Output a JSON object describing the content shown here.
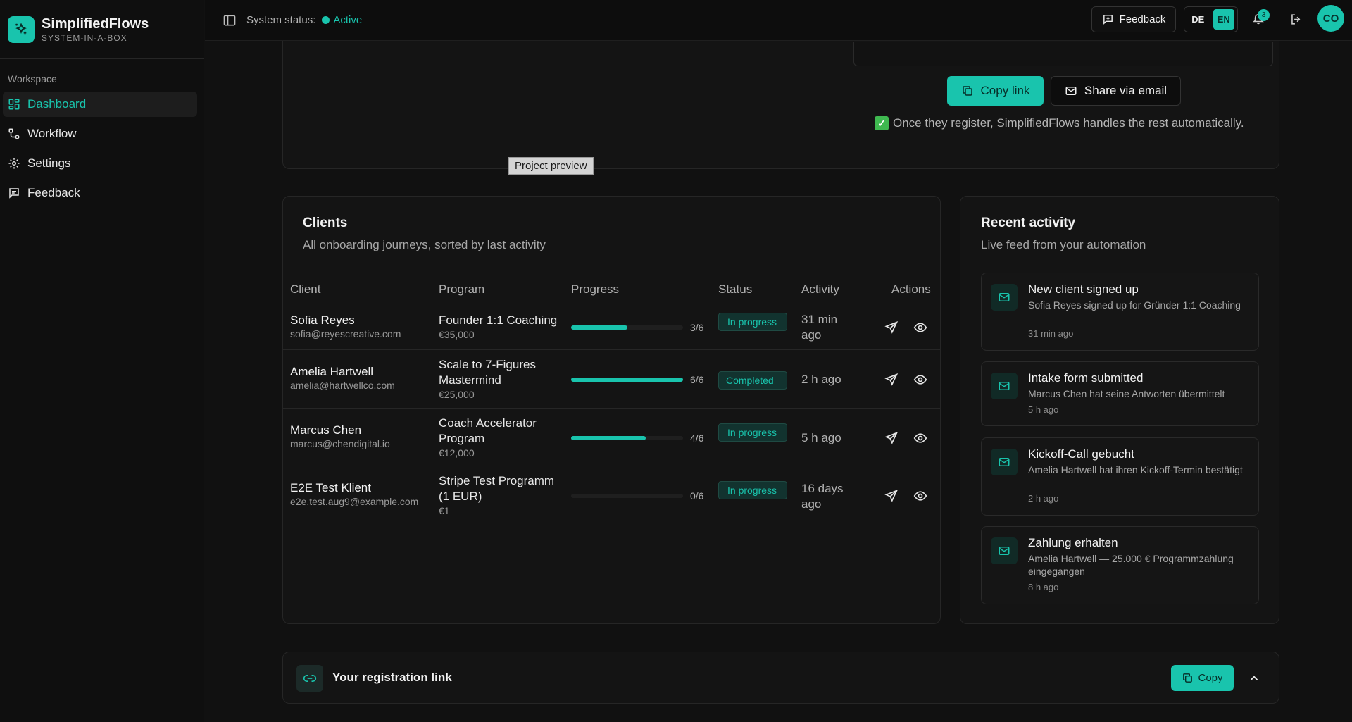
{
  "brand": {
    "name": "SimplifiedFlows",
    "tagline": "SYSTEM-IN-A-BOX"
  },
  "sidebar": {
    "section_label": "Workspace",
    "items": [
      {
        "label": "Dashboard",
        "icon": "dashboard-icon",
        "active": true
      },
      {
        "label": "Workflow",
        "icon": "workflow-icon",
        "active": false
      },
      {
        "label": "Settings",
        "icon": "gear-icon",
        "active": false
      },
      {
        "label": "Feedback",
        "icon": "message-icon",
        "active": false
      }
    ]
  },
  "topbar": {
    "status_label": "System status:",
    "status_value": "Active",
    "feedback_label": "Feedback",
    "lang_de": "DE",
    "lang_en": "EN",
    "lang_selected": "EN",
    "notification_count": "3",
    "avatar_initials": "CO"
  },
  "invite": {
    "copy_link_label": "Copy link",
    "share_email_label": "Share via email",
    "note": "Once they register, SimplifiedFlows handles the rest automatically.",
    "tooltip": "Project preview"
  },
  "clients": {
    "title": "Clients",
    "subtitle": "All onboarding journeys, sorted by last activity",
    "columns": [
      "Client",
      "Program",
      "Progress",
      "Status",
      "Activity",
      "Actions"
    ],
    "rows": [
      {
        "name": "Sofia Reyes",
        "email": "sofia@reyescreative.com",
        "program": "Founder 1:1 Coaching",
        "price": "€35,000",
        "progress_text": "3/6",
        "progress": 0.5,
        "status": "In progress",
        "activity": "31 min ago"
      },
      {
        "name": "Amelia Hartwell",
        "email": "amelia@hartwellco.com",
        "program": "Scale to 7-Figures Mastermind",
        "price": "€25,000",
        "progress_text": "6/6",
        "progress": 1.0,
        "status": "Completed",
        "activity": "2 h ago"
      },
      {
        "name": "Marcus Chen",
        "email": "marcus@chendigital.io",
        "program": "Coach Accelerator Program",
        "price": "€12,000",
        "progress_text": "4/6",
        "progress": 0.667,
        "status": "In progress",
        "activity": "5 h ago"
      },
      {
        "name": "E2E Test Klient",
        "email": "e2e.test.aug9@example.com",
        "program": "Stripe Test Programm (1 EUR)",
        "price": "€1",
        "progress_text": "0/6",
        "progress": 0,
        "status": "In progress",
        "activity": "16 days ago"
      }
    ]
  },
  "activity": {
    "title": "Recent activity",
    "subtitle": "Live feed from your automation",
    "items": [
      {
        "title": "New client signed up",
        "desc": "Sofia Reyes signed up for Gründer 1:1 Coaching",
        "time": "31 min ago"
      },
      {
        "title": "Intake form submitted",
        "desc": "Marcus Chen hat seine Antworten übermittelt",
        "time": "5 h ago"
      },
      {
        "title": "Kickoff-Call gebucht",
        "desc": "Amelia Hartwell hat ihren Kickoff-Termin bestätigt",
        "time": "2 h ago"
      },
      {
        "title": "Zahlung erhalten",
        "desc": "Amelia Hartwell — 25.000 € Programmzahlung eingegangen",
        "time": "8 h ago"
      }
    ]
  },
  "registration": {
    "title": "Your registration link",
    "copy_label": "Copy"
  },
  "colors": {
    "accent": "#19c4ad",
    "background": "#111111",
    "card": "#141414"
  }
}
